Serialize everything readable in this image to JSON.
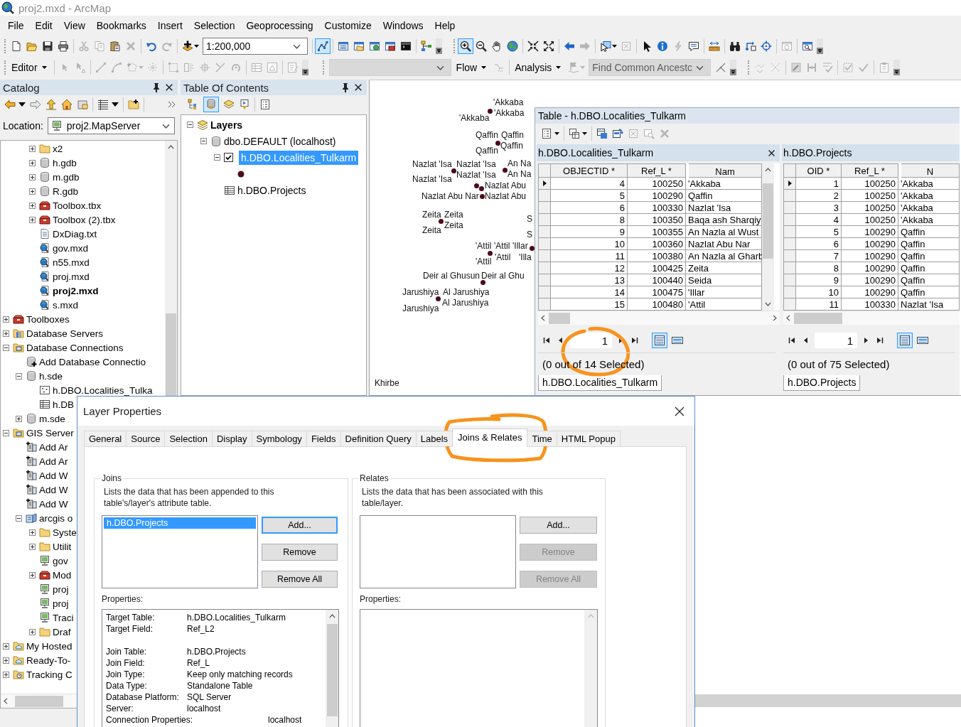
{
  "window": {
    "title": "proj2.mxd - ArcMap"
  },
  "menu_bar": [
    "File",
    "Edit",
    "View",
    "Bookmarks",
    "Insert",
    "Selection",
    "Geoprocessing",
    "Customize",
    "Windows",
    "Help"
  ],
  "toolbars": {
    "scale_field": "1:200,000",
    "editor_toolbar_pressed": true,
    "zoom_in_pressed": true,
    "editor_menu": "Editor",
    "empty_combo": {
      "disabled": true
    },
    "flow_menu": "Flow",
    "analysis_menu": "Analysis",
    "find_combo": {
      "value": "Find Common Ancestc",
      "disabled": true
    }
  },
  "catalog": {
    "title": "Catalog",
    "location_label": "Location:",
    "location_value": "proj2.MapServer",
    "scrolled_items": [
      {
        "label": "x2",
        "kind": "folder",
        "expanded": false,
        "current": false
      },
      {
        "label": "h.gdb",
        "kind": "gdb",
        "expanded": false,
        "current": false
      },
      {
        "label": "m.gdb",
        "kind": "gdb",
        "expanded": false,
        "current": false
      },
      {
        "label": "R.gdb",
        "kind": "gdb",
        "expanded": false,
        "current": false
      },
      {
        "label": "Toolbox.tbx",
        "kind": "toolbox",
        "expanded": false,
        "current": false
      },
      {
        "label": "Toolbox (2).tbx",
        "kind": "toolbox",
        "expanded": false,
        "current": false
      },
      {
        "label": "DxDiag.txt",
        "kind": "text",
        "current": false
      },
      {
        "label": "gov.mxd",
        "kind": "mxd",
        "current": false
      },
      {
        "label": "n55.mxd",
        "kind": "mxd",
        "current": false
      },
      {
        "label": "proj.mxd",
        "kind": "mxd",
        "current": false
      },
      {
        "label": "proj2.mxd",
        "kind": "mxd",
        "current": true
      },
      {
        "label": "s.mxd",
        "kind": "mxd",
        "current": false
      }
    ],
    "tree": [
      {
        "label": "Toolboxes",
        "kind": "toolboxes",
        "expanded": false
      },
      {
        "label": "Database Servers",
        "kind": "database-servers",
        "expanded": false
      },
      {
        "label": "Database Connections",
        "kind": "database-connections",
        "expanded": true,
        "children": [
          {
            "label": "Add Database Connectio",
            "kind": "add-connection"
          },
          {
            "label": "h.sde",
            "kind": "sde",
            "expanded": true,
            "children": [
              {
                "label": "h.DBO.Localities_Tulka",
                "kind": "feature-class"
              },
              {
                "label": "h.DB",
                "kind": "table"
              }
            ]
          },
          {
            "label": "m.sde",
            "kind": "sde",
            "expanded": false
          }
        ]
      },
      {
        "label": "GIS Server",
        "kind": "gis-servers",
        "expanded": true,
        "children": [
          {
            "label": "Add Ar",
            "kind": "add-server"
          },
          {
            "label": "Add Ar",
            "kind": "add-server"
          },
          {
            "label": "Add W",
            "kind": "add-server"
          },
          {
            "label": "Add W",
            "kind": "add-server"
          },
          {
            "label": "Add W",
            "kind": "add-server"
          },
          {
            "label": "arcgis o",
            "kind": "server",
            "expanded": true,
            "children": [
              {
                "label": "Syste",
                "kind": "folder",
                "expanded": false
              },
              {
                "label": "Utilit",
                "kind": "folder",
                "expanded": false
              },
              {
                "label": "gov",
                "kind": "map-service"
              },
              {
                "label": "Mod",
                "kind": "toolbox-service",
                "expanded": false
              },
              {
                "label": "proj",
                "kind": "map-service"
              },
              {
                "label": "proj",
                "kind": "map-service"
              },
              {
                "label": "Traci",
                "kind": "map-service"
              },
              {
                "label": "Draf",
                "kind": "drafts",
                "expanded": false
              }
            ]
          }
        ]
      },
      {
        "label": "My Hosted",
        "kind": "hosted",
        "expanded": false
      },
      {
        "label": "Ready-To-",
        "kind": "ready-to-use",
        "expanded": false
      },
      {
        "label": "Tracking C",
        "kind": "tracking",
        "expanded": false
      }
    ]
  },
  "toc": {
    "title": "Table Of Contents",
    "view_buttons": [
      {
        "selected": false
      },
      {
        "selected": true
      },
      {
        "selected": false
      },
      {
        "selected": false
      }
    ],
    "tree": [
      {
        "label": "Layers",
        "kind": "data-frame",
        "expanded": true,
        "children": [
          {
            "label": "dbo.DEFAULT (localhost)",
            "kind": "workspace",
            "expanded": true,
            "children": [
              {
                "label": "h.DBO.Localities_Tulkarm",
                "kind": "layer",
                "expanded": true,
                "checked": true,
                "selected": true
              },
              {
                "label": "h.DBO.Projects",
                "kind": "table",
                "selected": false
              }
            ]
          }
        ]
      }
    ]
  },
  "map": {
    "labels": [
      "'Akkaba",
      "'Akkaba",
      "'Akkaba",
      "Qaffin",
      "Qaffin",
      "Qaffin",
      "Qaffin",
      "Nazlat 'Isa",
      "Nazlat 'Isa",
      "An Na",
      "Nazlat 'Isa",
      "An Na",
      "Nazlat 'Isa",
      "Nazlat Abu",
      "Nazlat Abu Nar",
      "Nazlat Abu",
      "S",
      "S",
      "Zeita",
      "Zeita",
      "Zeita",
      "Zeita",
      "'Attil",
      "'Attil",
      "'Illar",
      "'Attil",
      "'Illa",
      "'Attil",
      "Deir al Ghusun",
      "Deir al Ghu",
      "Jarushiya",
      "Al Jarushiya",
      "Al Jarushiya",
      "Jarushiya",
      "Khirbe"
    ]
  },
  "table_window": {
    "title": "Table - h.DBO.Localities_Tulkarm",
    "panes": [
      {
        "title": "h.DBO.Localities_Tulkarm",
        "closable": true,
        "columns": [
          "OBJECTID *",
          "Ref_L *",
          "Nam"
        ],
        "rows": [
          {
            "cells": [
              "4",
              "100250",
              "'Akkaba"
            ],
            "current": true
          },
          {
            "cells": [
              "5",
              "100290",
              "Qaffin"
            ],
            "current": false
          },
          {
            "cells": [
              "6",
              "100330",
              "Nazlat 'Isa"
            ],
            "current": false
          },
          {
            "cells": [
              "8",
              "100350",
              "Baqa ash Sharqiy"
            ],
            "current": false
          },
          {
            "cells": [
              "9",
              "100355",
              "An Nazla al Wust"
            ],
            "current": false
          },
          {
            "cells": [
              "10",
              "100360",
              "Nazlat Abu Nar"
            ],
            "current": false
          },
          {
            "cells": [
              "11",
              "100380",
              "An Nazla al Gharb"
            ],
            "current": false
          },
          {
            "cells": [
              "12",
              "100425",
              "Zeita"
            ],
            "current": false
          },
          {
            "cells": [
              "13",
              "100440",
              "Seida"
            ],
            "current": false
          },
          {
            "cells": [
              "14",
              "100475",
              "'Illar"
            ],
            "current": false
          },
          {
            "cells": [
              "15",
              "100480",
              "'Attil"
            ],
            "current": false
          }
        ],
        "page": "1",
        "view_buttons": [
          {
            "selected": true
          },
          {
            "selected": false
          }
        ],
        "status": "(0 out of 14 Selected)",
        "tab": "h.DBO.Localities_Tulkarm"
      },
      {
        "title": "h.DBO.Projects",
        "closable": false,
        "columns": [
          "OID *",
          "Ref_L *",
          "N"
        ],
        "rows": [
          {
            "cells": [
              "1",
              "100250",
              "'Akkaba"
            ],
            "current": true
          },
          {
            "cells": [
              "2",
              "100250",
              "'Akkaba"
            ],
            "current": false
          },
          {
            "cells": [
              "3",
              "100250",
              "'Akkaba"
            ],
            "current": false
          },
          {
            "cells": [
              "4",
              "100250",
              "'Akkaba"
            ],
            "current": false
          },
          {
            "cells": [
              "5",
              "100290",
              "Qaffin"
            ],
            "current": false
          },
          {
            "cells": [
              "6",
              "100290",
              "Qaffin"
            ],
            "current": false
          },
          {
            "cells": [
              "7",
              "100290",
              "Qaffin"
            ],
            "current": false
          },
          {
            "cells": [
              "8",
              "100290",
              "Qaffin"
            ],
            "current": false
          },
          {
            "cells": [
              "9",
              "100290",
              "Qaffin"
            ],
            "current": false
          },
          {
            "cells": [
              "10",
              "100290",
              "Qaffin"
            ],
            "current": false
          },
          {
            "cells": [
              "11",
              "100330",
              "Nazlat 'Isa"
            ],
            "current": false
          }
        ],
        "page": "1",
        "view_buttons": [
          {
            "selected": true
          },
          {
            "selected": false
          }
        ],
        "status": "(0 out of 75 Selected)",
        "tab": "h.DBO.Projects"
      }
    ]
  },
  "layer_properties": {
    "title": "Layer Properties",
    "tabs": [
      {
        "label": "General",
        "selected": false
      },
      {
        "label": "Source",
        "selected": false
      },
      {
        "label": "Selection",
        "selected": false
      },
      {
        "label": "Display",
        "selected": false
      },
      {
        "label": "Symbology",
        "selected": false
      },
      {
        "label": "Fields",
        "selected": false
      },
      {
        "label": "Definition Query",
        "selected": false
      },
      {
        "label": "Labels",
        "selected": false
      },
      {
        "label": "Joins & Relates",
        "selected": true
      },
      {
        "label": "Time",
        "selected": false
      },
      {
        "label": "HTML Popup",
        "selected": false
      }
    ],
    "joins": {
      "title": "Joins",
      "description": "Lists the data that has been appended to this table's/layer's attribute table.",
      "items": [
        {
          "label": "h.DBO.Projects",
          "selected": true
        }
      ],
      "buttons": [
        {
          "label": "Add...",
          "disabled": false,
          "focused": true
        },
        {
          "label": "Remove",
          "disabled": false,
          "focused": false
        },
        {
          "label": "Remove All",
          "disabled": false,
          "focused": false
        }
      ],
      "properties_label": "Properties:",
      "properties": [
        [
          {
            "key": "Target Table:",
            "value": "h.DBO.Localities_Tulkarm",
            "kind": "field"
          },
          {
            "key": "Target Field:",
            "value": "Ref_L2",
            "kind": "field"
          }
        ],
        [
          {
            "key": "Join Table:",
            "value": "h.DBO.Projects",
            "kind": "field"
          },
          {
            "key": "Join Field:",
            "value": "Ref_L",
            "kind": "field"
          },
          {
            "key": "Join Type:",
            "value": "Keep only matching records",
            "kind": "field"
          },
          {
            "key": "Data Type:",
            "value": "Standalone Table",
            "kind": "field"
          },
          {
            "key": "Database Platform:",
            "value": "SQL Server",
            "kind": "field"
          },
          {
            "key": "Server:",
            "value": "localhost",
            "kind": "field"
          },
          {
            "key": "Connection Properties:",
            "value": "localhost",
            "kind": "group"
          }
        ]
      ]
    },
    "relates": {
      "title": "Relates",
      "description": "Lists the data that has been associated with this table/layer.",
      "buttons": [
        {
          "label": "Add...",
          "disabled": false,
          "focused": false
        },
        {
          "label": "Remove",
          "disabled": true,
          "focused": false
        },
        {
          "label": "Remove All",
          "disabled": true,
          "focused": false
        }
      ],
      "properties_label": "Properties:"
    }
  }
}
